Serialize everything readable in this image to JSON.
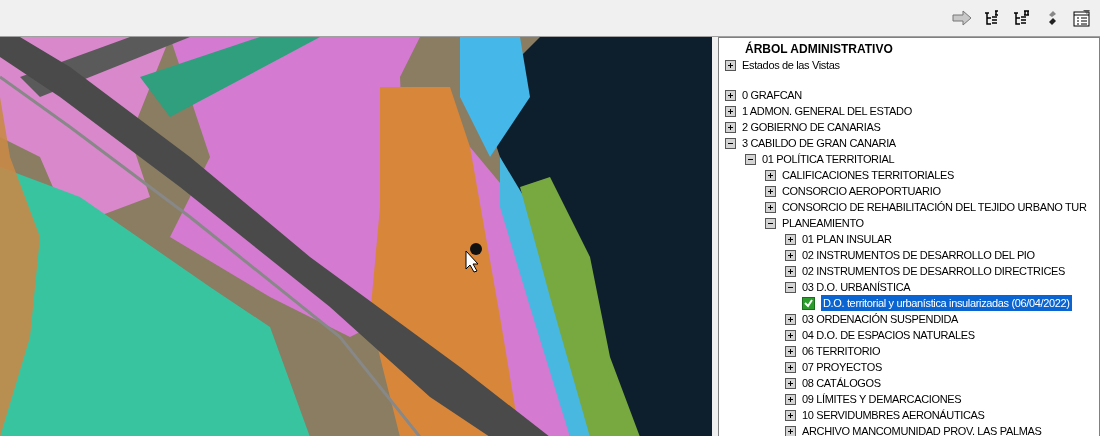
{
  "panel": {
    "title": "ÁRBOL ADMINISTRATIVO",
    "views": {
      "label": "Estados de las Vistas",
      "expanded": false
    },
    "tree": [
      {
        "label": "0 GRAFCAN",
        "expanded": false
      },
      {
        "label": "1 ADMON. GENERAL DEL ESTADO",
        "expanded": false
      },
      {
        "label": "2 GOBIERNO DE CANARIAS",
        "expanded": false
      },
      {
        "label": "3 CABILDO DE GRAN CANARIA",
        "expanded": true,
        "children": [
          {
            "label": "01 POLÍTICA TERRITORIAL",
            "expanded": true,
            "children": [
              {
                "label": "CALIFICACIONES TERRITORIALES",
                "expanded": false
              },
              {
                "label": "CONSORCIO AEROPORTUARIO",
                "expanded": false
              },
              {
                "label": "CONSORCIO DE REHABILITACIÓN DEL TEJIDO URBANO TUR",
                "expanded": false
              },
              {
                "label": "PLANEAMIENTO",
                "expanded": true,
                "children": [
                  {
                    "label": "01 PLAN INSULAR",
                    "expanded": false
                  },
                  {
                    "label": "02 INSTRUMENTOS DE DESARROLLO DEL PIO",
                    "expanded": false
                  },
                  {
                    "label": "02 INSTRUMENTOS DE DESARROLLO DIRECTRICES",
                    "expanded": false
                  },
                  {
                    "label": "03 D.O. URBANÍSTICA",
                    "expanded": true,
                    "children": [
                      {
                        "kind": "layer",
                        "label": "D.O. territorial y urbanística insularizadas (06/04/2022)",
                        "checked": true,
                        "selected": true
                      }
                    ]
                  },
                  {
                    "label": "03 ORDENACIÓN SUSPENDIDA",
                    "expanded": false
                  },
                  {
                    "label": "04 D.O. DE ESPACIOS NATURALES",
                    "expanded": false
                  },
                  {
                    "label": "06 TERRITORIO",
                    "expanded": false
                  },
                  {
                    "label": "07 PROYECTOS",
                    "expanded": false
                  },
                  {
                    "label": "08 CATÁLOGOS",
                    "expanded": false
                  },
                  {
                    "label": "09 LÍMITES Y DEMARCACIONES",
                    "expanded": false
                  },
                  {
                    "label": "10 SERVIDUMBRES AERONÁUTICAS",
                    "expanded": false
                  },
                  {
                    "label": "ARCHIVO MANCOMUNIDAD PROV. LAS PALMAS",
                    "expanded": false
                  }
                ]
              }
            ]
          }
        ]
      }
    ]
  }
}
